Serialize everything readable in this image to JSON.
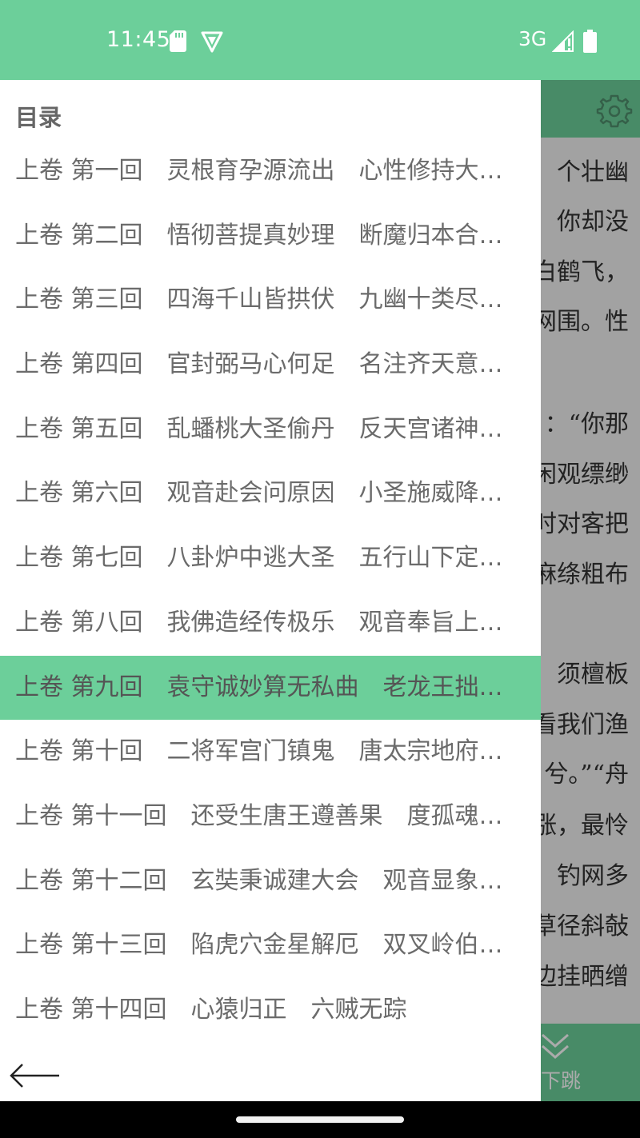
{
  "status_bar": {
    "time": "11:45",
    "network": "3G",
    "icons": [
      "sd-card-icon",
      "vpn-shield-icon",
      "signal-icon",
      "battery-icon"
    ]
  },
  "reader_bg": {
    "lines": [
      "个壮幽",
      "你却没",
      "白鹤飞，",
      "网围。性",
      "：“你那",
      "闲观缥缈",
      "时对客把",
      "麻绦粗布",
      "须檀板",
      "看我们渔",
      "兮。”“舟",
      "涨，最怜",
      "钓网多",
      "草径斜敧",
      "边挂晒缯"
    ],
    "jump_label": "下跳"
  },
  "drawer": {
    "title": "目录",
    "chapters": [
      "上卷 第一回　灵根育孕源流出　心性修持大道生",
      "上卷 第二回　悟彻菩提真妙理　断魔归本合元神",
      "上卷 第三回　四海千山皆拱伏　九幽十类尽除名",
      "上卷 第四回　官封弼马心何足　名注齐天意未宁",
      "上卷 第五回　乱蟠桃大圣偷丹　反天宫诸神捉怪",
      "上卷 第六回　观音赴会问原因　小圣施威降大圣",
      "上卷 第七回　八卦炉中逃大圣　五行山下定心猿",
      "上卷 第八回　我佛造经传极乐　观音奉旨上长安",
      "上卷 第九回　袁守诚妙算无私曲　老龙王拙计犯天条",
      "上卷 第十回　二将军宫门镇鬼　唐太宗地府还魂",
      "上卷 第十一回　还受生唐王遵善果　度孤魂萧瑀正空门",
      "上卷 第十二回　玄奘秉诚建大会　观音显象化金蝉",
      "上卷 第十三回　陷虎穴金星解厄　双叉岭伯钦留僧",
      "上卷 第十四回　心猿归正　六贼无踪"
    ],
    "active_index": 8
  },
  "colors": {
    "accent": "#6ccf9a",
    "drawer_bg": "#ffffff",
    "text": "#6b6b6b"
  }
}
